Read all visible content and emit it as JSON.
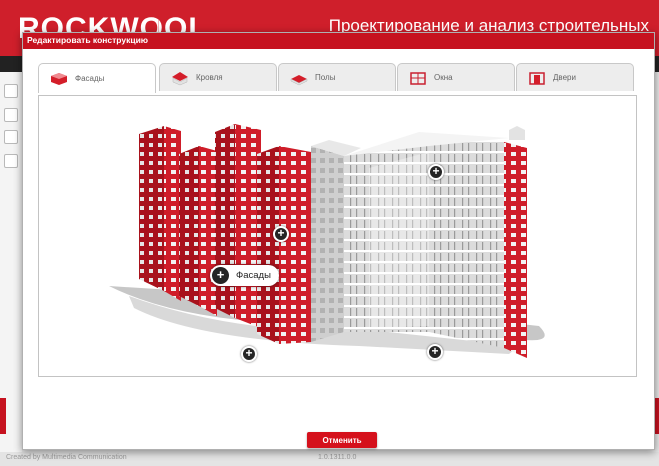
{
  "app": {
    "logo": "ROCKWOOL",
    "logo_sub": "",
    "title": "Проектирование и анализ строительных"
  },
  "modal": {
    "title": "Редактировать конструкцию",
    "tabs": [
      {
        "label": "Фасады",
        "icon": "facade-icon",
        "active": true
      },
      {
        "label": "Кровля",
        "icon": "roof-icon",
        "active": false
      },
      {
        "label": "Полы",
        "icon": "floor-icon",
        "active": false
      },
      {
        "label": "Окна",
        "icon": "window-icon",
        "active": false
      },
      {
        "label": "Двери",
        "icon": "door-icon",
        "active": false
      }
    ],
    "hotspot_label": "Фасады",
    "cancel_label": "Отменить"
  },
  "footer": {
    "left": "Created by Multimedia Communication",
    "version": "1.0.1311.0.0"
  },
  "colors": {
    "brand_red": "#cf1f2b",
    "button_red": "#d5111c"
  }
}
